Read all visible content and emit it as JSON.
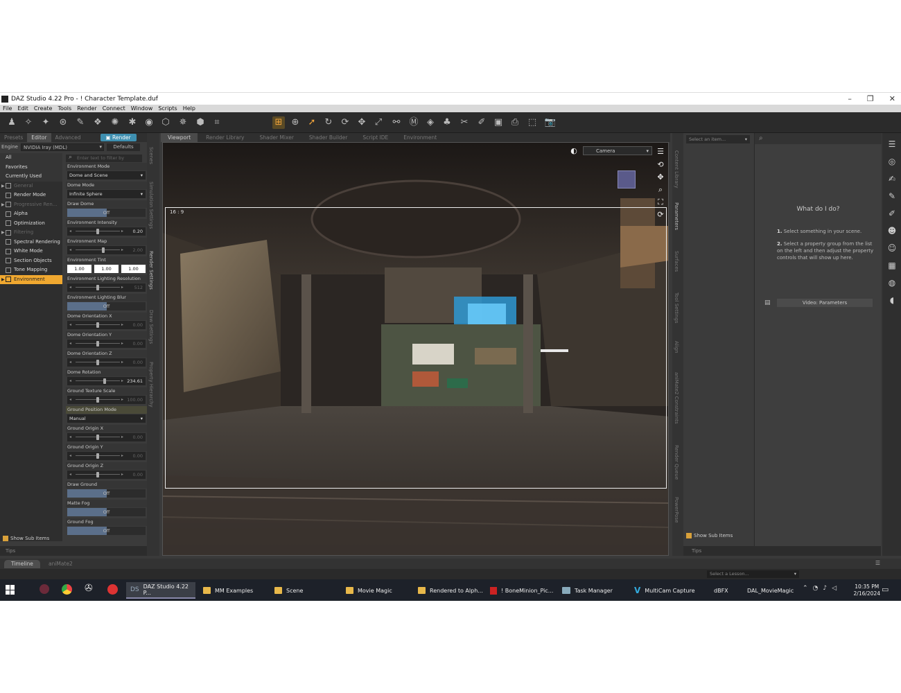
{
  "window": {
    "title": "DAZ Studio 4.22 Pro - ! Character Template.duf",
    "controls": [
      "–",
      "❐",
      "✕"
    ]
  },
  "menu": [
    "File",
    "Edit",
    "Create",
    "Tools",
    "Render",
    "Connect",
    "Window",
    "Scripts",
    "Help"
  ],
  "left_panel": {
    "tabs": [
      "Presets",
      "Editor",
      "Advanced"
    ],
    "render_button": "Render",
    "engine_label": "Engine",
    "engine_value": "NVIDIA Iray (MDL)",
    "defaults_button": "Defaults",
    "filter_placeholder": "Enter text to filter by",
    "categories": [
      {
        "label": "All",
        "kind": "group"
      },
      {
        "label": "Favorites",
        "kind": "group"
      },
      {
        "label": "Currently Used",
        "kind": "group"
      },
      {
        "label": "General",
        "kind": "dim"
      },
      {
        "label": "Render Mode",
        "kind": "item"
      },
      {
        "label": "Progressive Ren...",
        "kind": "dim"
      },
      {
        "label": "Alpha",
        "kind": "item"
      },
      {
        "label": "Optimization",
        "kind": "item"
      },
      {
        "label": "Filtering",
        "kind": "dim"
      },
      {
        "label": "Spectral Rendering",
        "kind": "item"
      },
      {
        "label": "White Mode",
        "kind": "item"
      },
      {
        "label": "Section Objects",
        "kind": "item"
      },
      {
        "label": "Tone Mapping",
        "kind": "item"
      },
      {
        "label": "Environment",
        "kind": "active"
      }
    ],
    "properties": {
      "env_mode": {
        "label": "Environment Mode",
        "value": "Dome and Scene"
      },
      "dome_mode": {
        "label": "Dome Mode",
        "value": "Infinite Sphere"
      },
      "draw_dome": {
        "label": "Draw Dome",
        "value": "Off"
      },
      "env_intensity": {
        "label": "Environment Intensity",
        "value": "0.20"
      },
      "env_map": {
        "label": "Environment Map",
        "value": "2.00"
      },
      "env_tint": {
        "label": "Environment Tint",
        "r": "1.00",
        "g": "1.00",
        "b": "1.00"
      },
      "env_light_res": {
        "label": "Environment Lighting Resolution",
        "value": "512"
      },
      "env_light_blur": {
        "label": "Environment Lighting Blur",
        "value": "Off"
      },
      "dome_orient_x": {
        "label": "Dome Orientation X",
        "value": "0.00"
      },
      "dome_orient_y": {
        "label": "Dome Orientation Y",
        "value": "0.00"
      },
      "dome_orient_z": {
        "label": "Dome Orientation Z",
        "value": "0.00"
      },
      "dome_rotation": {
        "label": "Dome Rotation",
        "value": "234.61"
      },
      "ground_tex_scale": {
        "label": "Ground Texture Scale",
        "value": "100.00"
      },
      "ground_pos_mode": {
        "label": "Ground Position Mode",
        "value": "Manual"
      },
      "ground_origin_x": {
        "label": "Ground Origin X",
        "value": "0.00"
      },
      "ground_origin_y": {
        "label": "Ground Origin Y",
        "value": "0.00"
      },
      "ground_origin_z": {
        "label": "Ground Origin Z",
        "value": "0.00"
      },
      "draw_ground": {
        "label": "Draw Ground",
        "value": "Off"
      },
      "matte_fog": {
        "label": "Matte Fog",
        "value": "Off"
      },
      "ground_fog": {
        "label": "Ground Fog",
        "value": "Off"
      }
    },
    "show_sub_items": "Show Sub Items",
    "tips": "Tips",
    "vertical_tabs": [
      "Scenes",
      "Simulation Settings",
      "Render Settings",
      "Draw Settings",
      "Property Hierarchy"
    ]
  },
  "viewport": {
    "tabs": [
      "Viewport",
      "Render Library",
      "Shader Mixer",
      "Shader Builder",
      "Script IDE",
      "Environment"
    ],
    "aspect": "16 : 9",
    "camera": "Camera"
  },
  "right_panel": {
    "select_item": "Select an item...",
    "vertical_tabs": [
      "Content Library",
      "Parameters",
      "Surfaces",
      "Tool Settings",
      "Align",
      "aniMate2 Constraints",
      "Render Queue",
      "PowerPose"
    ],
    "help_title": "What do I do?",
    "step1_num": "1.",
    "step1": "Select something in your scene.",
    "step2_num": "2.",
    "step2": "Select a property group from the list on the left and then adjust the property controls that will show up here.",
    "video_button": "Video: Parameters",
    "show_sub_items": "Show Sub Items",
    "tips": "Tips"
  },
  "bottom": {
    "tabs": [
      "Timeline",
      "aniMate2"
    ],
    "lesson": "Select a Lesson..."
  },
  "taskbar": {
    "items": [
      {
        "label": "DAZ Studio 4.22 P...",
        "icon": "daz-icon",
        "active": true
      },
      {
        "label": "MM Examples",
        "icon": "folder-icon"
      },
      {
        "label": "Scene",
        "icon": "folder-icon"
      },
      {
        "label": "Movie Magic",
        "icon": "folder-icon"
      },
      {
        "label": "Rendered to Alph...",
        "icon": "folder-icon"
      },
      {
        "label": "! BoneMinion_Pic...",
        "icon": "pdf-icon"
      },
      {
        "label": "Task Manager",
        "icon": "taskmgr-icon"
      },
      {
        "label": "MultiCam Capture",
        "icon": "multicam-icon"
      }
    ],
    "extra1": "dBFX",
    "extra2": "DAL_MovieMagic",
    "time": "10:35 PM",
    "date": "2/16/2024"
  },
  "colors": {
    "accent": "#f0a830",
    "render_button": "#3e8fb0",
    "panel": "#3b3b3b"
  }
}
